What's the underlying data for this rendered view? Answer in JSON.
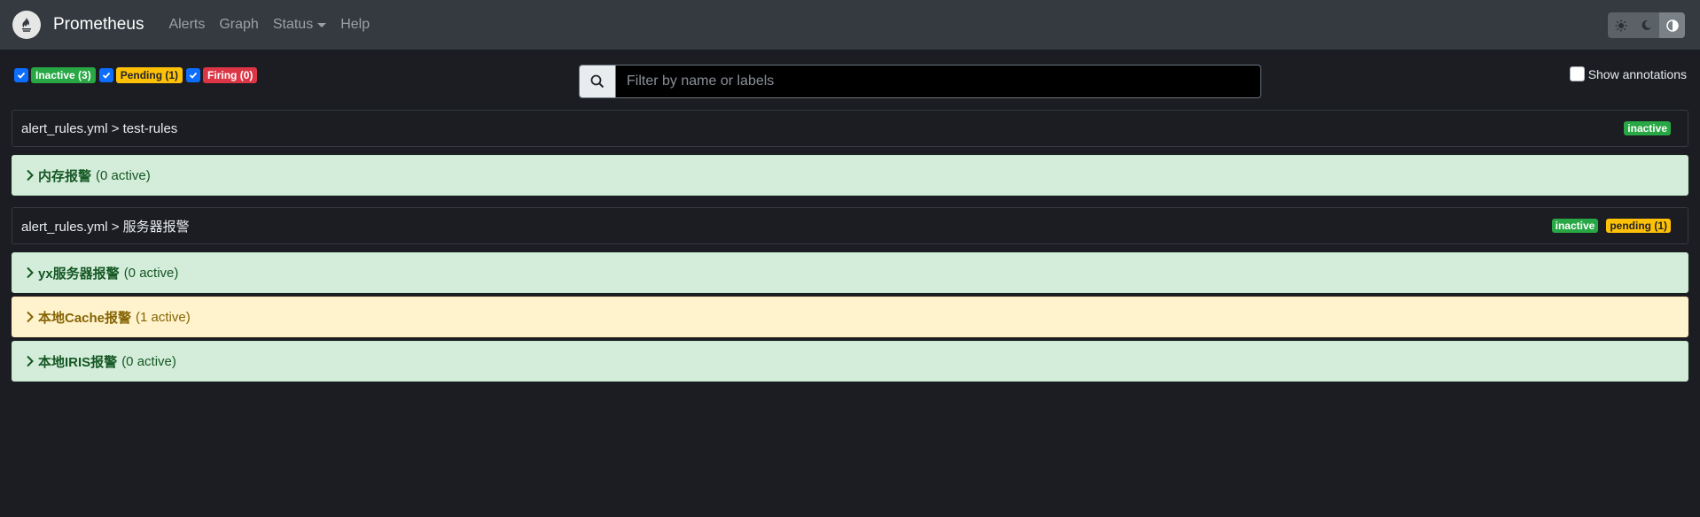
{
  "navbar": {
    "brand": "Prometheus",
    "links": [
      "Alerts",
      "Graph",
      "Status",
      "Help"
    ],
    "theme_buttons": [
      "sun-icon",
      "moon-icon",
      "contrast-icon"
    ]
  },
  "filters": {
    "inactive": "Inactive (3)",
    "pending": "Pending (1)",
    "firing": "Firing (0)"
  },
  "search": {
    "placeholder": "Filter by name or labels",
    "value": ""
  },
  "annotations_label": "Show annotations",
  "groups": [
    {
      "title": "alert_rules.yml > test-rules",
      "badges": [
        "inactive"
      ],
      "rules": [
        {
          "name": "内存报警",
          "status": "(0 active)"
        }
      ]
    },
    {
      "title": "alert_rules.yml > 服务器报警",
      "badges": [
        "inactive",
        "pending (1)"
      ],
      "rules": [
        {
          "name": "yx服务器报警",
          "status": "(0 active)"
        },
        {
          "name": "本地Cache报警",
          "status": "(1 active)"
        },
        {
          "name": "本地IRIS报警",
          "status": "(0 active)"
        }
      ]
    }
  ],
  "colors": {
    "inactive": "#28a745",
    "pending": "#ffc107",
    "firing": "#dc3545",
    "rule_ok_bg": "#d4edda",
    "rule_pending_bg": "#fff3cd"
  }
}
